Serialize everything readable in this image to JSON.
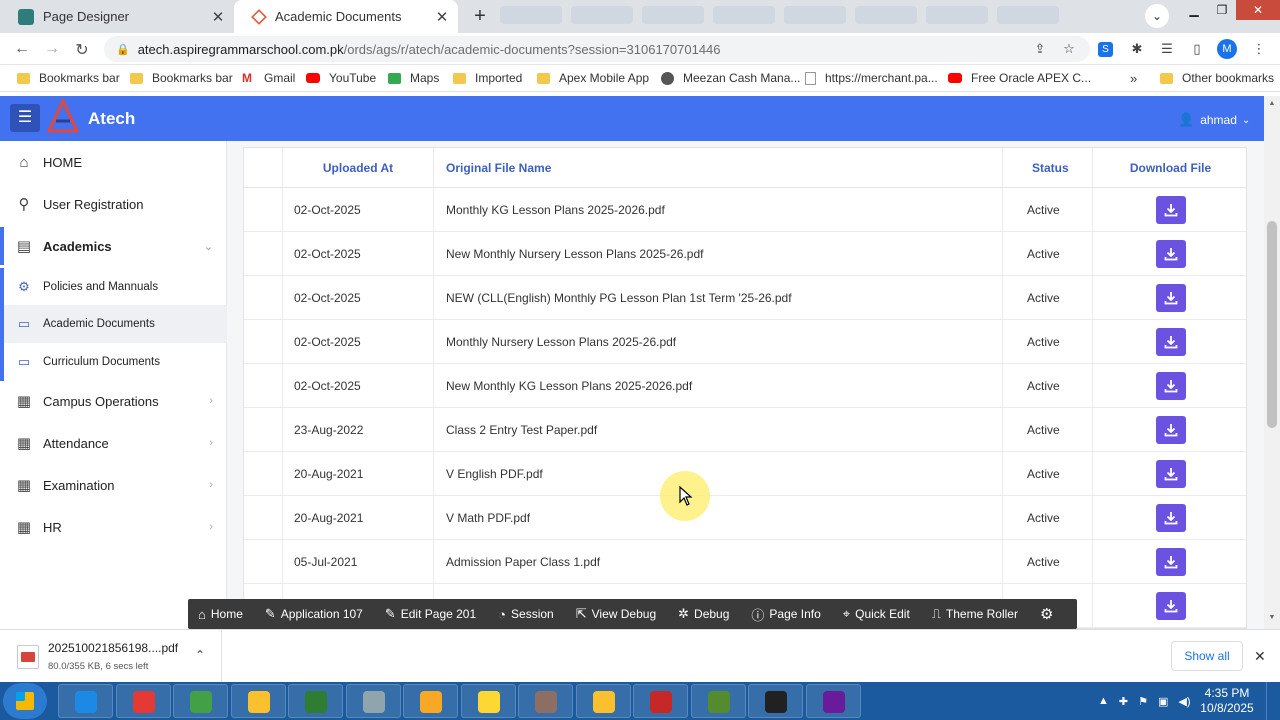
{
  "browser": {
    "tabs": [
      {
        "title": "Page Designer",
        "icon": "apex-page-designer-icon",
        "active": false
      },
      {
        "title": "Academic Documents",
        "icon": "apex-app-icon",
        "active": true
      }
    ],
    "url_host": "atech.aspiregrammarschool.com.pk",
    "url_path": "/ords/ags/r/atech/academic-documents?session=3106170701446",
    "profile_initial": "M",
    "bookmarks": [
      {
        "label": "Bookmarks bar",
        "icon": "folder-icon"
      },
      {
        "label": "Bookmarks bar",
        "icon": "folder-icon"
      },
      {
        "label": "Gmail",
        "icon": "gmail-icon"
      },
      {
        "label": "YouTube",
        "icon": "youtube-icon"
      },
      {
        "label": "Maps",
        "icon": "maps-icon"
      },
      {
        "label": "Imported",
        "icon": "folder-icon"
      },
      {
        "label": "Apex Mobile App",
        "icon": "folder-icon"
      },
      {
        "label": "Meezan Cash Mana...",
        "icon": "globe-icon"
      },
      {
        "label": "https://merchant.pa...",
        "icon": "page-icon"
      },
      {
        "label": "Free Oracle APEX C...",
        "icon": "youtube-icon"
      }
    ],
    "bookmarks_overflow": "»",
    "other_bookmarks": "Other bookmarks"
  },
  "app": {
    "title": "Atech",
    "user": "ahmad",
    "brand_color": "#4272f0",
    "download_button_color": "#6c52e0"
  },
  "sidebar": {
    "items": [
      {
        "label": "HOME",
        "icon": "home-icon",
        "level": 1
      },
      {
        "label": "User Registration",
        "icon": "user-add-icon",
        "level": 1
      },
      {
        "label": "Academics",
        "icon": "book-icon",
        "level": 1,
        "expanded": true
      },
      {
        "label": "Policies and Mannuals",
        "icon": "gear-icon",
        "level": 2
      },
      {
        "label": "Academic Documents",
        "icon": "document-icon",
        "level": 2,
        "selected": true
      },
      {
        "label": "Curriculum Documents",
        "icon": "document-icon",
        "level": 2
      },
      {
        "label": "Campus Operations",
        "icon": "building-icon",
        "level": 1,
        "has_children": true
      },
      {
        "label": "Attendance",
        "icon": "building-icon",
        "level": 1,
        "has_children": true
      },
      {
        "label": "Examination",
        "icon": "building-icon",
        "level": 1,
        "has_children": true
      },
      {
        "label": "HR",
        "icon": "building-icon",
        "level": 1,
        "has_children": true
      }
    ]
  },
  "table": {
    "headers": [
      "Uploaded At",
      "Original File Name",
      "Status",
      "Download File"
    ],
    "rows": [
      {
        "uploaded": "02-Oct-2025",
        "file": "Monthly KG Lesson Plans 2025-2026.pdf",
        "status": "Active"
      },
      {
        "uploaded": "02-Oct-2025",
        "file": "New Monthly Nursery Lesson Plans 2025-26.pdf",
        "status": "Active"
      },
      {
        "uploaded": "02-Oct-2025",
        "file": "NEW (CLL(English) Monthly PG Lesson Plan 1st Term '25-26.pdf",
        "status": "Active"
      },
      {
        "uploaded": "02-Oct-2025",
        "file": "Monthly Nursery Lesson Plans 2025-26.pdf",
        "status": "Active"
      },
      {
        "uploaded": "02-Oct-2025",
        "file": "New Monthly KG Lesson Plans 2025-2026.pdf",
        "status": "Active"
      },
      {
        "uploaded": "23-Aug-2022",
        "file": "Class 2 Entry Test Paper.pdf",
        "status": "Active"
      },
      {
        "uploaded": "20-Aug-2021",
        "file": "V English PDF.pdf",
        "status": "Active"
      },
      {
        "uploaded": "20-Aug-2021",
        "file": "V Math PDF.pdf",
        "status": "Active"
      },
      {
        "uploaded": "05-Jul-2021",
        "file": "Admission Paper Class 1.pdf",
        "status": "Active"
      },
      {
        "uploaded": "",
        "file": "",
        "status": ""
      }
    ]
  },
  "dev_toolbar": [
    {
      "label": "Home",
      "icon": "home-icon"
    },
    {
      "label": "Application 107",
      "icon": "edit-icon"
    },
    {
      "label": "Edit Page 201",
      "icon": "edit-icon"
    },
    {
      "label": "Session",
      "icon": "session-icon"
    },
    {
      "label": "View Debug",
      "icon": "external-icon"
    },
    {
      "label": "Debug",
      "icon": "bug-icon"
    },
    {
      "label": "Page Info",
      "icon": "info-icon"
    },
    {
      "label": "Quick Edit",
      "icon": "quick-edit-icon"
    },
    {
      "label": "Theme Roller",
      "icon": "paint-roller-icon"
    }
  ],
  "download_shelf": {
    "file_name": "202510021856198....pdf",
    "progress": "80.0/355 KB, 6 secs left",
    "show_all": "Show all"
  },
  "taskbar": {
    "time": "4:35 PM",
    "date": "10/8/2025",
    "apps": [
      "internet-explorer-icon",
      "chrome-icon",
      "remote-desktop-icon",
      "apex-icon",
      "excel-icon",
      "tool-icon",
      "outlook-icon",
      "file-explorer-icon",
      "paint-icon",
      "apex-icon",
      "calendar-icon",
      "frog-icon",
      "cmd-icon",
      "recorder-icon"
    ]
  }
}
